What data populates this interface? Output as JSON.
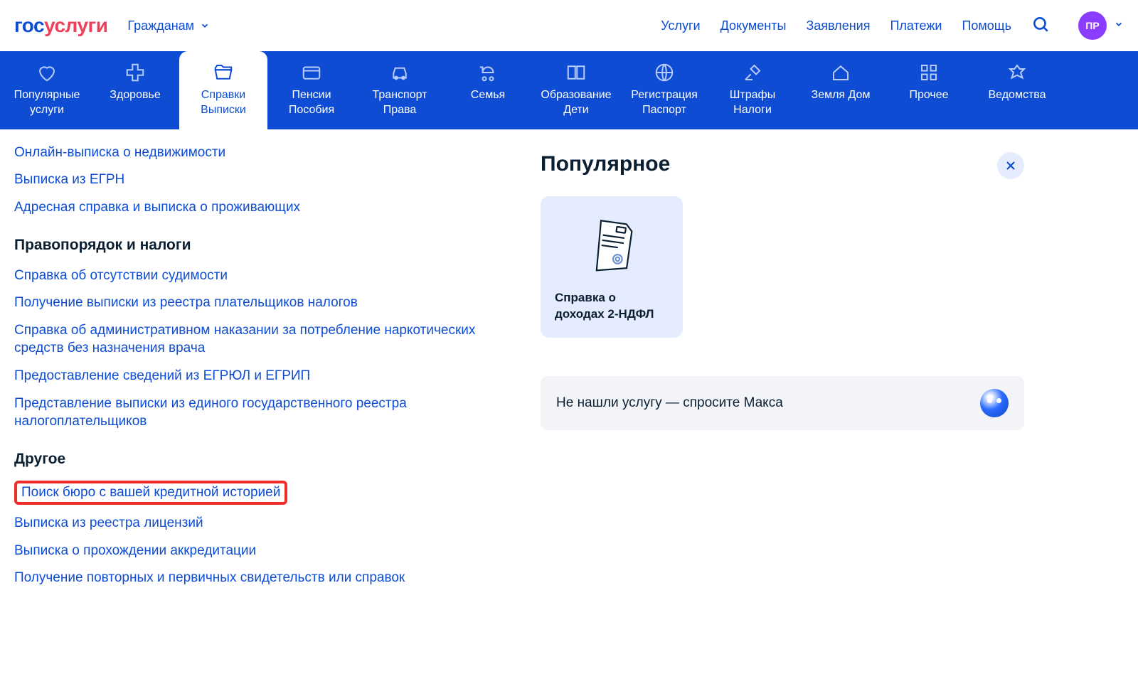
{
  "header": {
    "logo_part1": "гос",
    "logo_part2": "услуги",
    "citizens_label": "Гражданам",
    "nav": [
      "Услуги",
      "Документы",
      "Заявления",
      "Платежи",
      "Помощь"
    ],
    "avatar_initials": "ПР"
  },
  "tabs": [
    {
      "label": "Популярные услуги",
      "icon": "heart"
    },
    {
      "label": "Здоровье",
      "icon": "plus"
    },
    {
      "label": "Справки Выписки",
      "icon": "folder",
      "active": true
    },
    {
      "label": "Пенсии Пособия",
      "icon": "wallet"
    },
    {
      "label": "Транспорт Права",
      "icon": "car"
    },
    {
      "label": "Семья",
      "icon": "stroller"
    },
    {
      "label": "Образование Дети",
      "icon": "book"
    },
    {
      "label": "Регистрация Паспорт",
      "icon": "globe"
    },
    {
      "label": "Штрафы Налоги",
      "icon": "gavel"
    },
    {
      "label": "Земля Дом",
      "icon": "house"
    },
    {
      "label": "Прочее",
      "icon": "grid"
    },
    {
      "label": "Ведомства",
      "icon": "eagle"
    }
  ],
  "left": {
    "top_links": [
      "Онлайн-выписка о недвижимости",
      "Выписка из ЕГРН",
      "Адресная справка и выписка о проживающих"
    ],
    "section1_title": "Правопорядок и налоги",
    "section1_links": [
      "Справка об отсутствии судимости",
      "Получение выписки из реестра плательщиков налогов",
      "Справка об административном наказании за потребление наркотических средств без назначения врача",
      "Предоставление сведений из ЕГРЮЛ и ЕГРИП",
      "Представление выписки из единого государственного реестра налогоплательщиков"
    ],
    "section2_title": "Другое",
    "section2_highlighted": "Поиск бюро с вашей кредитной историей",
    "section2_links": [
      "Выписка из реестра лицензий",
      "Выписка о прохождении аккредитации",
      "Получение повторных и первичных свидетельств или справок"
    ]
  },
  "right": {
    "popular_title": "Популярное",
    "card_title": "Справка о доходах 2-НДФЛ",
    "ask_text": "Не нашли услугу — спросите Макса"
  }
}
